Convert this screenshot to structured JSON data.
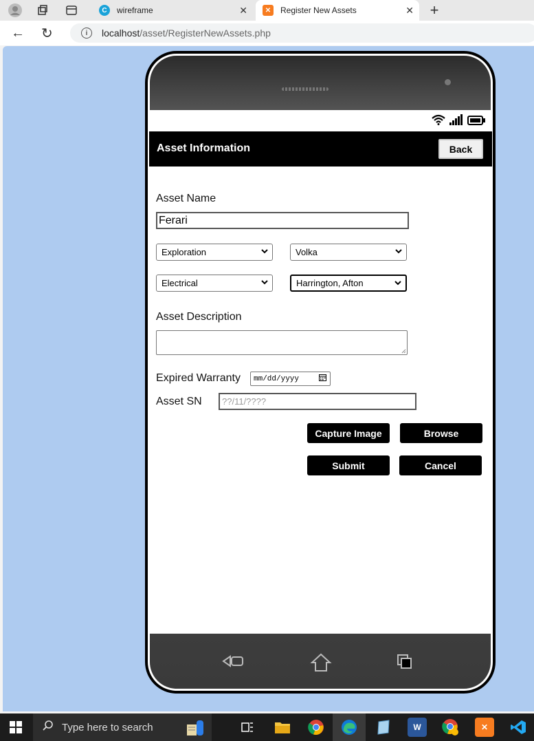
{
  "browser": {
    "tabs": [
      {
        "title": "wireframe",
        "favicon": "canva-icon"
      },
      {
        "title": "Register New Assets",
        "favicon": "xampp-icon"
      }
    ],
    "url_host": "localhost",
    "url_path": "/asset/RegisterNewAssets.php"
  },
  "app": {
    "header_title": "Asset Information",
    "back_label": "Back",
    "asset_name_label": "Asset Name",
    "asset_name_value": "Ferari",
    "selects": {
      "department": "Exploration",
      "location": "Volka",
      "asset_group": "Electrical",
      "employee": "Harrington, Afton"
    },
    "asset_description_label": "Asset Description",
    "asset_description_value": "",
    "expired_warranty_label": "Expired Warranty",
    "expired_warranty_placeholder": "mm/dd/yyyy",
    "asset_sn_label": "Asset SN",
    "asset_sn_placeholder": "??/11/????",
    "buttons": {
      "capture": "Capture Image",
      "browse": "Browse",
      "submit": "Submit",
      "cancel": "Cancel"
    }
  },
  "taskbar": {
    "search_placeholder": "Type here to search"
  },
  "colors": {
    "page_bg": "#aecbf0",
    "accent": "#000000"
  }
}
